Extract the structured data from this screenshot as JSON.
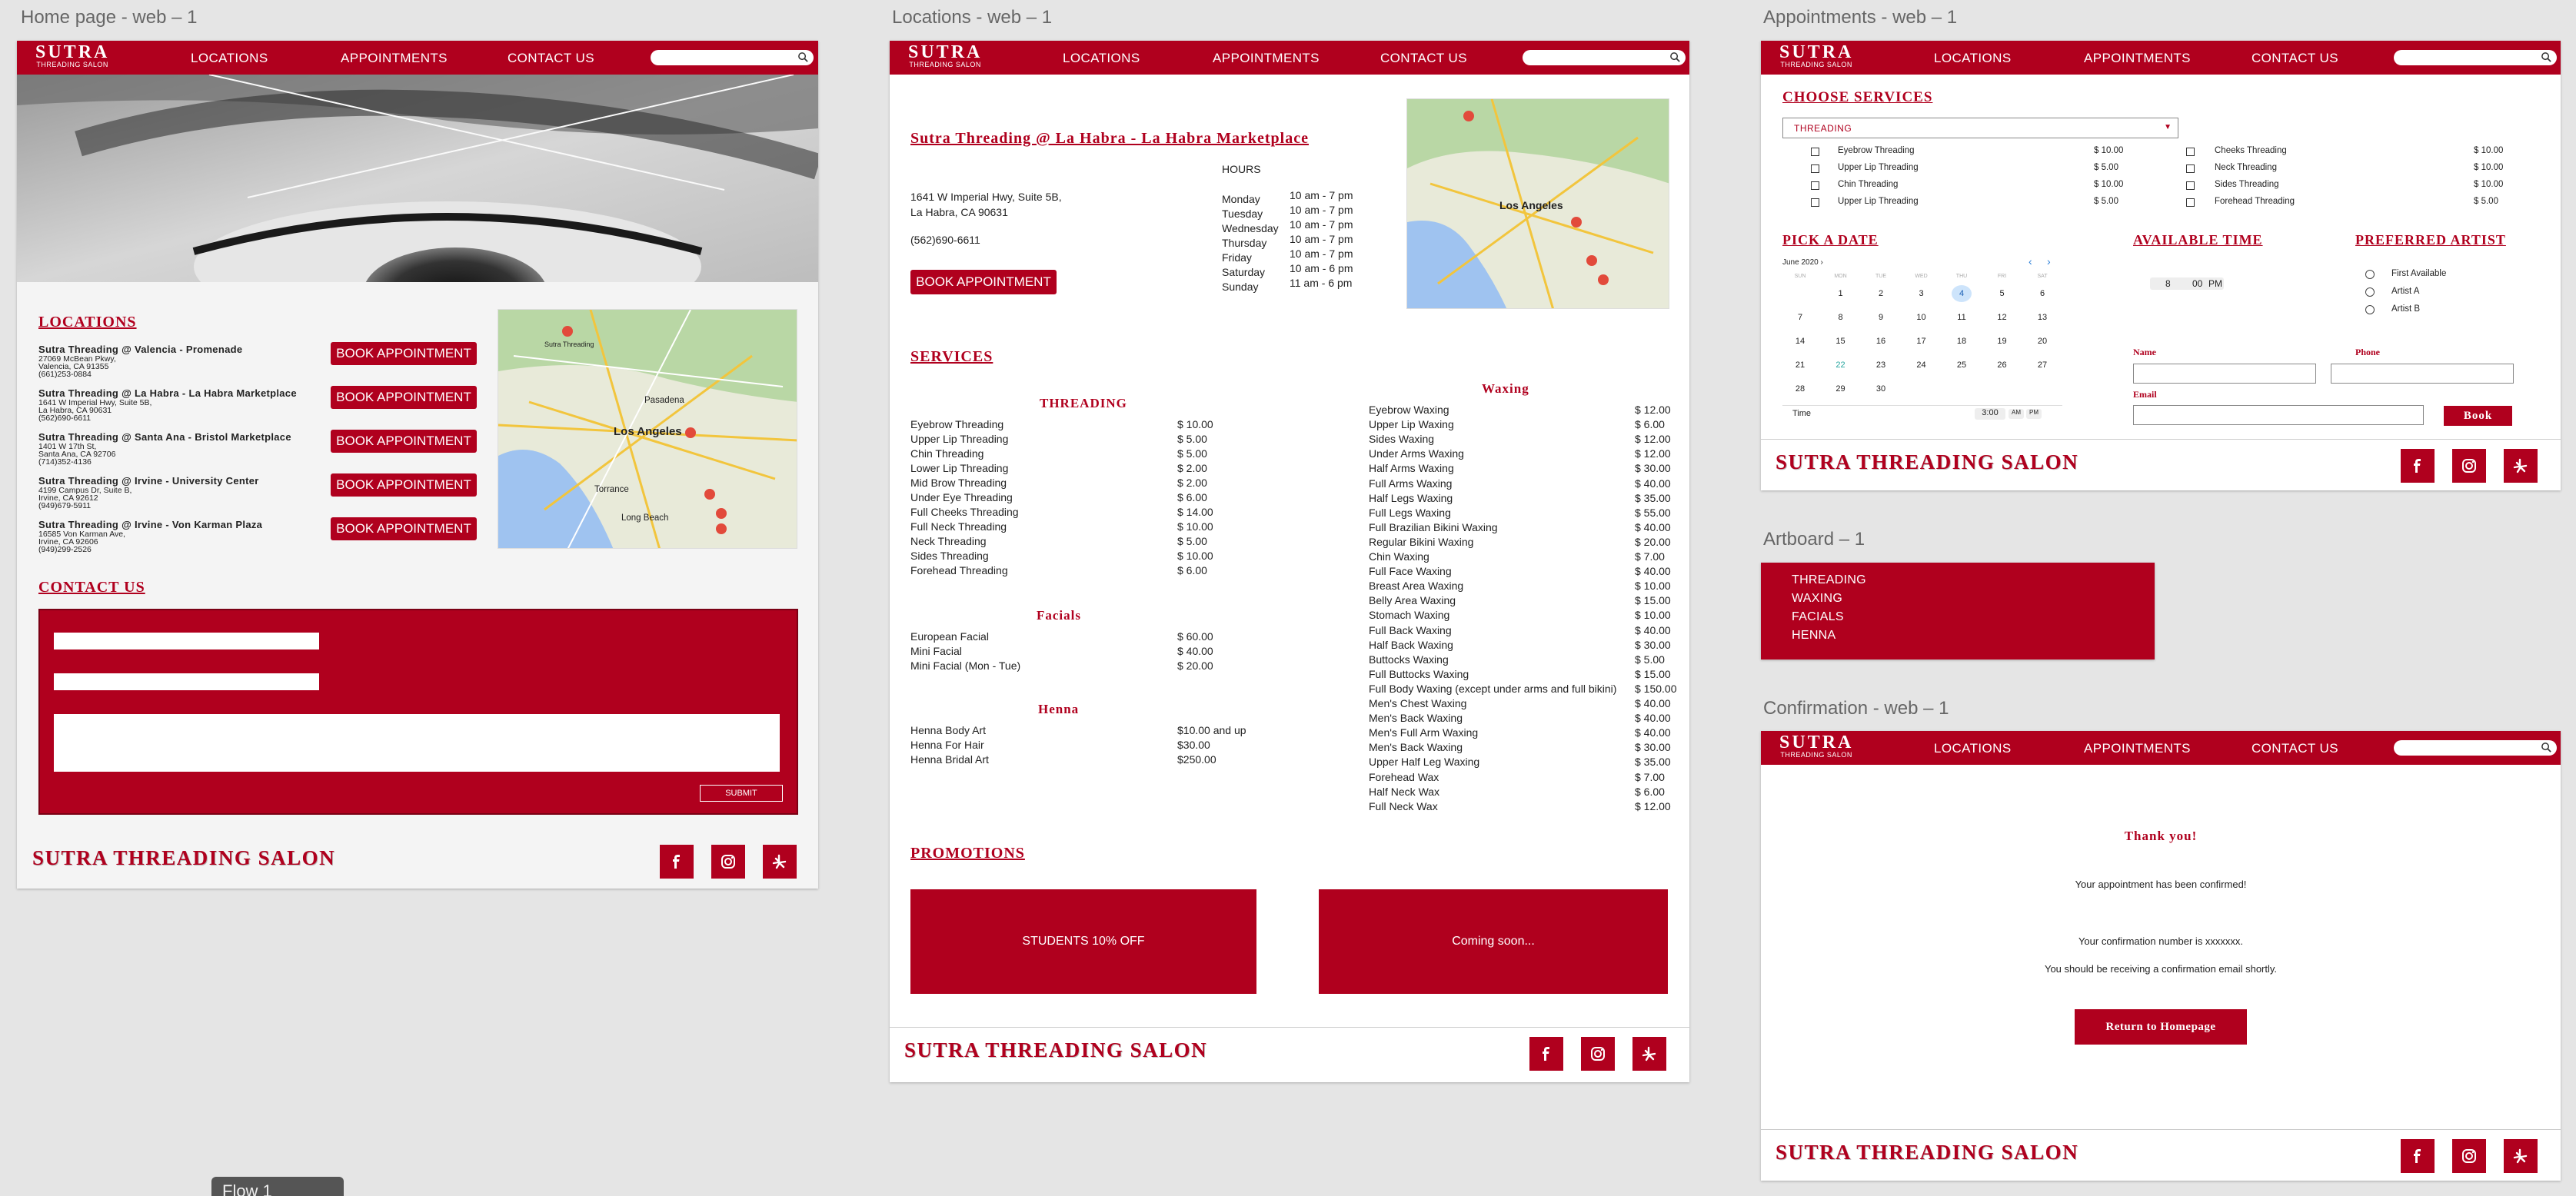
{
  "nav": {
    "brand": "SUTRA",
    "brand_sub": "THREADING SALON",
    "links": [
      "LOCATIONS",
      "APPOINTMENTS",
      "CONTACT US"
    ]
  },
  "footer": {
    "title": "SUTRA THREADING SALON"
  },
  "boards": {
    "home": "Home page - web – 1",
    "locations": "Locations - web – 1",
    "appointments": "Appointments - web – 1",
    "artboard": "Artboard – 1",
    "confirmation": "Confirmation - web – 1"
  },
  "home": {
    "locations_heading": "LOCATIONS",
    "locations": [
      {
        "name": "Sutra Threading @ Valencia - Promenade",
        "lines": "27069 McBean Pkwy,\nValencia, CA 91355\n(661)253-0884"
      },
      {
        "name": "Sutra Threading @ La Habra - La Habra Marketplace",
        "lines": "1641 W Imperial Hwy, Suite 5B,\nLa Habra, CA 90631\n(562)690-6611"
      },
      {
        "name": "Sutra Threading @ Santa Ana - Bristol Marketplace",
        "lines": "1401 W 17th St,\nSanta Ana, CA 92706\n(714)352-4136"
      },
      {
        "name": "Sutra Threading @ Irvine - University Center",
        "lines": "4199 Campus Dr, Suite B,\nIrvine, CA 92612\n(949)679-5911"
      },
      {
        "name": "Sutra Threading @ Irvine - Von Karman Plaza",
        "lines": "16585 Von Karman Ave,\nIrvine, CA 92606\n(949)299-2526"
      }
    ],
    "book_label": "BOOK APPOINTMENT",
    "contact_heading": "CONTACT US",
    "submit_label": "SUBMIT"
  },
  "map_labels": {
    "city": "Los Angeles",
    "pasadena": "Pasadena",
    "torrance": "Torrance",
    "long_beach": "Long Beach",
    "sutra": "Sutra Threading"
  },
  "locpage": {
    "title": "Sutra Threading @ La Habra - La Habra Marketplace",
    "address": "1641 W Imperial Hwy, Suite 5B,\nLa Habra, CA 90631",
    "phone": "(562)690-6611",
    "book_label": "BOOK APPOINTMENT",
    "hours_heading": "HOURS",
    "hours": [
      {
        "day": "Monday",
        "time": "10 am - 7 pm"
      },
      {
        "day": "Tuesday",
        "time": "10 am - 7 pm"
      },
      {
        "day": "Wednesday",
        "time": "10 am - 7 pm"
      },
      {
        "day": "Thursday",
        "time": "10 am - 7 pm"
      },
      {
        "day": "Friday",
        "time": "10 am - 7 pm"
      },
      {
        "day": "Saturday",
        "time": "10 am - 6 pm"
      },
      {
        "day": "Sunday",
        "time": "11 am - 6 pm"
      }
    ],
    "services_heading": "SERVICES",
    "threading_heading": "THREADING",
    "threading": [
      [
        "Eyebrow Threading",
        "$ 10.00"
      ],
      [
        "Upper Lip Threading",
        "$ 5.00"
      ],
      [
        "Chin Threading",
        "$ 5.00"
      ],
      [
        "Lower Lip Threading",
        "$ 2.00"
      ],
      [
        "Mid Brow Threading",
        "$ 2.00"
      ],
      [
        "Under Eye Threading",
        "$ 6.00"
      ],
      [
        "Full Cheeks Threading",
        "$ 14.00"
      ],
      [
        "Full Neck Threading",
        "$ 10.00"
      ],
      [
        "Neck Threading",
        "$ 5.00"
      ],
      [
        "Sides Threading",
        "$ 10.00"
      ],
      [
        "Forehead Threading",
        "$ 6.00"
      ]
    ],
    "facials_heading": "Facials",
    "facials": [
      [
        "European Facial",
        "$ 60.00"
      ],
      [
        "Mini Facial",
        "$ 40.00"
      ],
      [
        "Mini Facial (Mon - Tue)",
        "$ 20.00"
      ]
    ],
    "henna_heading": "Henna",
    "henna": [
      [
        "Henna Body Art",
        "$10.00 and up"
      ],
      [
        "Henna For Hair",
        "$30.00"
      ],
      [
        "Henna Bridal Art",
        "$250.00"
      ]
    ],
    "waxing_heading": "Waxing",
    "waxing": [
      [
        "Eyebrow Waxing",
        "$ 12.00"
      ],
      [
        "Upper Lip Waxing",
        "$ 6.00"
      ],
      [
        "Sides Waxing",
        "$ 12.00"
      ],
      [
        "Under Arms Waxing",
        "$ 12.00"
      ],
      [
        "Half Arms Waxing",
        "$ 30.00"
      ],
      [
        "Full Arms Waxing",
        "$ 40.00"
      ],
      [
        "Half Legs Waxing",
        "$ 35.00"
      ],
      [
        "Full Legs Waxing",
        "$ 55.00"
      ],
      [
        "Full Brazilian Bikini Waxing",
        "$ 40.00"
      ],
      [
        "Regular Bikini Waxing",
        "$ 20.00"
      ],
      [
        "Chin Waxing",
        "$ 7.00"
      ],
      [
        "Full Face Waxing",
        "$ 40.00"
      ],
      [
        "Breast Area Waxing",
        "$ 10.00"
      ],
      [
        "Belly Area Waxing",
        "$ 15.00"
      ],
      [
        "Stomach Waxing",
        "$ 10.00"
      ],
      [
        "Full Back Waxing",
        "$ 40.00"
      ],
      [
        "Half Back Waxing",
        "$ 30.00"
      ],
      [
        "Buttocks Waxing",
        "$ 5.00"
      ],
      [
        "Full Buttocks Waxing",
        "$ 15.00"
      ],
      [
        "Full Body Waxing (except under arms and full bikini)",
        "$ 150.00"
      ],
      [
        "Men's Chest Waxing",
        "$ 40.00"
      ],
      [
        "Men's Back Waxing",
        "$ 40.00"
      ],
      [
        "Men's Full Arm Waxing",
        "$ 40.00"
      ],
      [
        "Men's Back Waxing",
        "$ 30.00"
      ],
      [
        "Upper Half Leg Waxing",
        "$ 35.00"
      ],
      [
        "Forehead Wax",
        "$ 7.00"
      ],
      [
        "Half Neck Wax",
        "$ 6.00"
      ],
      [
        "Full Neck Wax",
        "$ 12.00"
      ]
    ],
    "promotions_heading": "PROMOTIONS",
    "promo1": "STUDENTS 10% OFF",
    "promo2": "Coming soon..."
  },
  "appt": {
    "choose_heading": "CHOOSE SERVICES",
    "select_value": "THREADING",
    "services_left": [
      [
        "Eyebrow Threading",
        "$ 10.00"
      ],
      [
        "Upper Lip Threading",
        "$ 5.00"
      ],
      [
        "Chin Threading",
        "$ 10.00"
      ],
      [
        "Upper Lip Threading",
        "$ 5.00"
      ]
    ],
    "services_right": [
      [
        "Cheeks Threading",
        "$ 10.00"
      ],
      [
        "Neck Threading",
        "$ 10.00"
      ],
      [
        "Sides Threading",
        "$ 10.00"
      ],
      [
        "Forehead Threading",
        "$ 5.00"
      ]
    ],
    "date_heading": "PICK A DATE",
    "month": "June 2020",
    "weekdays": [
      "SUN",
      "MON",
      "TUE",
      "WED",
      "THU",
      "FRI",
      "SAT"
    ],
    "weeks": [
      [
        "",
        "1",
        "2",
        "3",
        "4",
        "5",
        "6"
      ],
      [
        "7",
        "8",
        "9",
        "10",
        "11",
        "12",
        "13"
      ],
      [
        "14",
        "15",
        "16",
        "17",
        "18",
        "19",
        "20"
      ],
      [
        "21",
        "22",
        "23",
        "24",
        "25",
        "26",
        "27"
      ],
      [
        "28",
        "29",
        "30",
        "",
        "",
        "",
        ""
      ]
    ],
    "selected_day": "4",
    "time_label": "Time",
    "time_value": "3:00",
    "am": "AM",
    "pm": "PM",
    "avail_heading": "AVAILABLE TIME",
    "picker_hour": "8",
    "picker_min": "00",
    "picker_ampm": "PM",
    "artist_heading": "PREFERRED ARTIST",
    "artists": [
      "First Available",
      "Artist A",
      "Artist B"
    ],
    "name_label": "Name",
    "phone_label": "Phone",
    "email_label": "Email",
    "book_label": "Book"
  },
  "dropdown": {
    "items": [
      "THREADING",
      "WAXING",
      "FACIALS",
      "HENNA"
    ]
  },
  "confirm": {
    "thank": "Thank you!",
    "line1": "Your appointment has been confirmed!",
    "line2": "Your confirmation number is xxxxxxx.",
    "line3": "You should be receiving a confirmation email shortly.",
    "return_label": "Return to Homepage"
  },
  "flow": {
    "label": "Flow 1"
  },
  "colors": {
    "brand": "#b0001e",
    "background": "#e5e5e5"
  }
}
